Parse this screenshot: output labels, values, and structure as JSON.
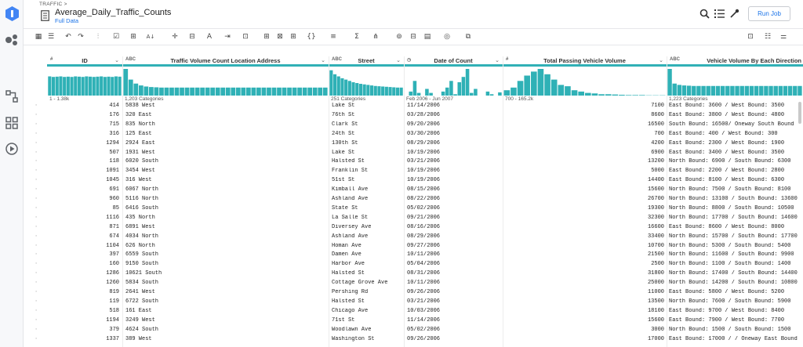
{
  "app": {
    "breadcrumb": "TRAFFIC >",
    "title": "Average_Daily_Traffic_Counts",
    "subtitle": "Full Data",
    "run_button": "Run Job"
  },
  "rail_icons": [
    "dataprep-logo",
    "flows-icon",
    "connections-icon",
    "library-icon",
    "jobs-icon"
  ],
  "toolbar_icons": [
    "grid-view-icon",
    "list-view-icon",
    "undo-icon",
    "redo-icon",
    "filter-rows-icon",
    "checklist-icon",
    "merge-columns-icon",
    "sort-icon",
    "split-icon",
    "columns-icon",
    "text-format-icon",
    "extract-icon",
    "conditions-icon",
    "table-ops-icon",
    "pivot-icon",
    "window-icon",
    "braces-icon",
    "filter-icon",
    "sigma-icon",
    "hierarchy-icon",
    "join-icon",
    "comment-icon",
    "target-icon",
    "copy-icon",
    "layout-icon",
    "settings-sliders-icon"
  ],
  "columns": [
    {
      "type": "#",
      "name": "ID",
      "summary": "1 - 1.38k"
    },
    {
      "type": "ABC",
      "name": "Traffic Volume Count Location  Address",
      "summary": "1,203 Categories"
    },
    {
      "type": "ABC",
      "name": "Street",
      "summary": "251 Categories"
    },
    {
      "type": "clock",
      "name": "Date of Count",
      "summary": "Feb 2006 - Jun 2007"
    },
    {
      "type": "#",
      "name": "Total Passing Vehicle Volume",
      "summary": "700 - 165.2k"
    },
    {
      "type": "ABC",
      "name": "Vehicle Volume By Each Direction",
      "summary": "1,223 Categories"
    }
  ],
  "histograms": {
    "id": [
      0.72,
      0.7,
      0.71,
      0.72,
      0.7,
      0.71,
      0.7,
      0.72,
      0.71,
      0.7,
      0.72,
      0.71,
      0.7,
      0.71,
      0.72,
      0.7,
      0.71,
      0.7,
      0.72,
      0.71
    ],
    "address": [
      1.0,
      0.6,
      0.45,
      0.38,
      0.34,
      0.32,
      0.31,
      0.3,
      0.3,
      0.3,
      0.3,
      0.3,
      0.3,
      0.3,
      0.3,
      0.3,
      0.3,
      0.3,
      0.3,
      0.3,
      0.3,
      0.3,
      0.3,
      0.3,
      0.3,
      0.3,
      0.3,
      0.3,
      0.3,
      0.3,
      0.3,
      0.3,
      0.3,
      0.3,
      0.3,
      0.3,
      0.3,
      0.3,
      0.3,
      0.3
    ],
    "street": [
      0.95,
      0.8,
      0.72,
      0.65,
      0.6,
      0.55,
      0.5,
      0.47,
      0.44,
      0.42,
      0.4,
      0.38,
      0.36,
      0.35,
      0.34,
      0.33,
      0.32,
      0.31,
      0.3,
      0.3
    ],
    "date": [
      0,
      0.15,
      0.55,
      0.1,
      0,
      0.25,
      0.1,
      0,
      0,
      0.15,
      0.3,
      0.55,
      0.05,
      0.5,
      0.7,
      1.0,
      0.1,
      0.25,
      0,
      0,
      0.15,
      0.05,
      0,
      0.12
    ],
    "volume": [
      0.2,
      0.3,
      0.55,
      0.75,
      0.9,
      1.0,
      0.8,
      0.6,
      0.4,
      0.35,
      0.2,
      0.15,
      0.1,
      0.08,
      0.05,
      0.05,
      0.04,
      0.03,
      0.02,
      0.02,
      0.02,
      0.01,
      0.01,
      0.01
    ],
    "direction": [
      1.0,
      0.45,
      0.4,
      0.38,
      0.37,
      0.36,
      0.36,
      0.36,
      0.36,
      0.36,
      0.36,
      0.36,
      0.36,
      0.36,
      0.36,
      0.36,
      0.36,
      0.36,
      0.36,
      0.36,
      0.36,
      0.36,
      0.36,
      0.36,
      0.36,
      0.36,
      0.36,
      0.36
    ]
  },
  "rows": [
    {
      "id": "414",
      "addr": "5838 West",
      "street": "Lake St",
      "date": "11/14/2006",
      "vol": "7100",
      "dir": "East Bound: 3600 / West Bound: 3500"
    },
    {
      "id": "176",
      "addr": "320 East",
      "street": "76th St",
      "date": "03/28/2006",
      "vol": "8600",
      "dir": "East Bound: 3800 / West Bound: 4800"
    },
    {
      "id": "715",
      "addr": "835 North",
      "street": "Clark St",
      "date": "09/20/2006",
      "vol": "16500",
      "dir": "South Bound: 16500/ Oneway South Bound"
    },
    {
      "id": "316",
      "addr": "125 East",
      "street": "24th St",
      "date": "03/30/2006",
      "vol": "700",
      "dir": "East Bound: 400 / West Bound: 300"
    },
    {
      "id": "1294",
      "addr": "2924 East",
      "street": "130th St",
      "date": "08/29/2006",
      "vol": "4200",
      "dir": "East Bound: 2300 / West Bound: 1900"
    },
    {
      "id": "507",
      "addr": "1931 West",
      "street": "Lake St",
      "date": "10/19/2006",
      "vol": "6900",
      "dir": "East Bound: 3400 / West Bound: 3500"
    },
    {
      "id": "118",
      "addr": "6020 South",
      "street": "Halsted St",
      "date": "03/21/2006",
      "vol": "13200",
      "dir": "North Bound: 6900 / South Bound: 6300"
    },
    {
      "id": "1091",
      "addr": "3454 West",
      "street": "Franklin St",
      "date": "10/19/2006",
      "vol": "5000",
      "dir": "East Bound: 2200 / West Bound: 2800"
    },
    {
      "id": "1045",
      "addr": "316 West",
      "street": "51st St",
      "date": "10/19/2006",
      "vol": "14400",
      "dir": "East Bound: 8100 / West Bound: 6300"
    },
    {
      "id": "691",
      "addr": "6067 North",
      "street": "Kimball Ave",
      "date": "08/15/2006",
      "vol": "15600",
      "dir": "North Bound: 7500 / South Bound: 8100"
    },
    {
      "id": "960",
      "addr": "5116 North",
      "street": "Ashland Ave",
      "date": "08/22/2006",
      "vol": "26700",
      "dir": "North Bound: 13100 / South Bound: 13600"
    },
    {
      "id": "85",
      "addr": "6416 South",
      "street": "State St",
      "date": "05/02/2006",
      "vol": "19300",
      "dir": "North Bound: 8800 / South Bound: 10500"
    },
    {
      "id": "1116",
      "addr": "435 North",
      "street": "La Salle St",
      "date": "09/21/2006",
      "vol": "32300",
      "dir": "North Bound: 17700 / South Bound: 14600"
    },
    {
      "id": "871",
      "addr": "6891 West",
      "street": "Diversey Ave",
      "date": "08/16/2006",
      "vol": "16600",
      "dir": "East Bound: 8600 / West Bound: 8000"
    },
    {
      "id": "674",
      "addr": "4034 North",
      "street": "Ashland Ave",
      "date": "08/29/2006",
      "vol": "33400",
      "dir": "North Bound: 15700 / South Bound: 17700"
    },
    {
      "id": "1104",
      "addr": "626 North",
      "street": "Homan Ave",
      "date": "09/27/2006",
      "vol": "10700",
      "dir": "North Bound: 5300 / South Bound: 5400"
    },
    {
      "id": "397",
      "addr": "6559 South",
      "street": "Damen Ave",
      "date": "10/11/2006",
      "vol": "21500",
      "dir": "North Bound: 11600 / South Bound: 9900"
    },
    {
      "id": "160",
      "addr": "9150 South",
      "street": "Harbor Ave",
      "date": "05/04/2006",
      "vol": "2500",
      "dir": "North Bound: 1100 / South Bound: 1400"
    },
    {
      "id": "1286",
      "addr": "10621 South",
      "street": "Halsted St",
      "date": "08/31/2006",
      "vol": "31800",
      "dir": "North Bound: 17400 / South Bound: 14400"
    },
    {
      "id": "1260",
      "addr": "5834 South",
      "street": "Cottage Grove Ave",
      "date": "10/11/2006",
      "vol": "25000",
      "dir": "North Bound: 14200 / South Bound: 10800"
    },
    {
      "id": "819",
      "addr": "2641 West",
      "street": "Pershing Rd",
      "date": "09/26/2006",
      "vol": "11000",
      "dir": "East Bound: 5800 / West Bound: 5200"
    },
    {
      "id": "119",
      "addr": "6722 South",
      "street": "Halsted St",
      "date": "03/21/2006",
      "vol": "13500",
      "dir": "North Bound: 7600 / South Bound: 5900"
    },
    {
      "id": "518",
      "addr": "161 East",
      "street": "Chicago Ave",
      "date": "10/03/2006",
      "vol": "18100",
      "dir": "East Bound: 9700 / West Bound: 8400"
    },
    {
      "id": "1194",
      "addr": "3249 West",
      "street": "71st St",
      "date": "11/14/2006",
      "vol": "15600",
      "dir": "East Bound: 7900 / West Bound: 7700"
    },
    {
      "id": "379",
      "addr": "4624 South",
      "street": "Woodlawn Ave",
      "date": "05/02/2006",
      "vol": "3000",
      "dir": "North Bound: 1500 / South Bound: 1500"
    },
    {
      "id": "1337",
      "addr": "389 West",
      "street": "Washington St",
      "date": "09/26/2006",
      "vol": "17000",
      "dir": "East Bound: 17000 / / Oneway East Bound"
    }
  ]
}
